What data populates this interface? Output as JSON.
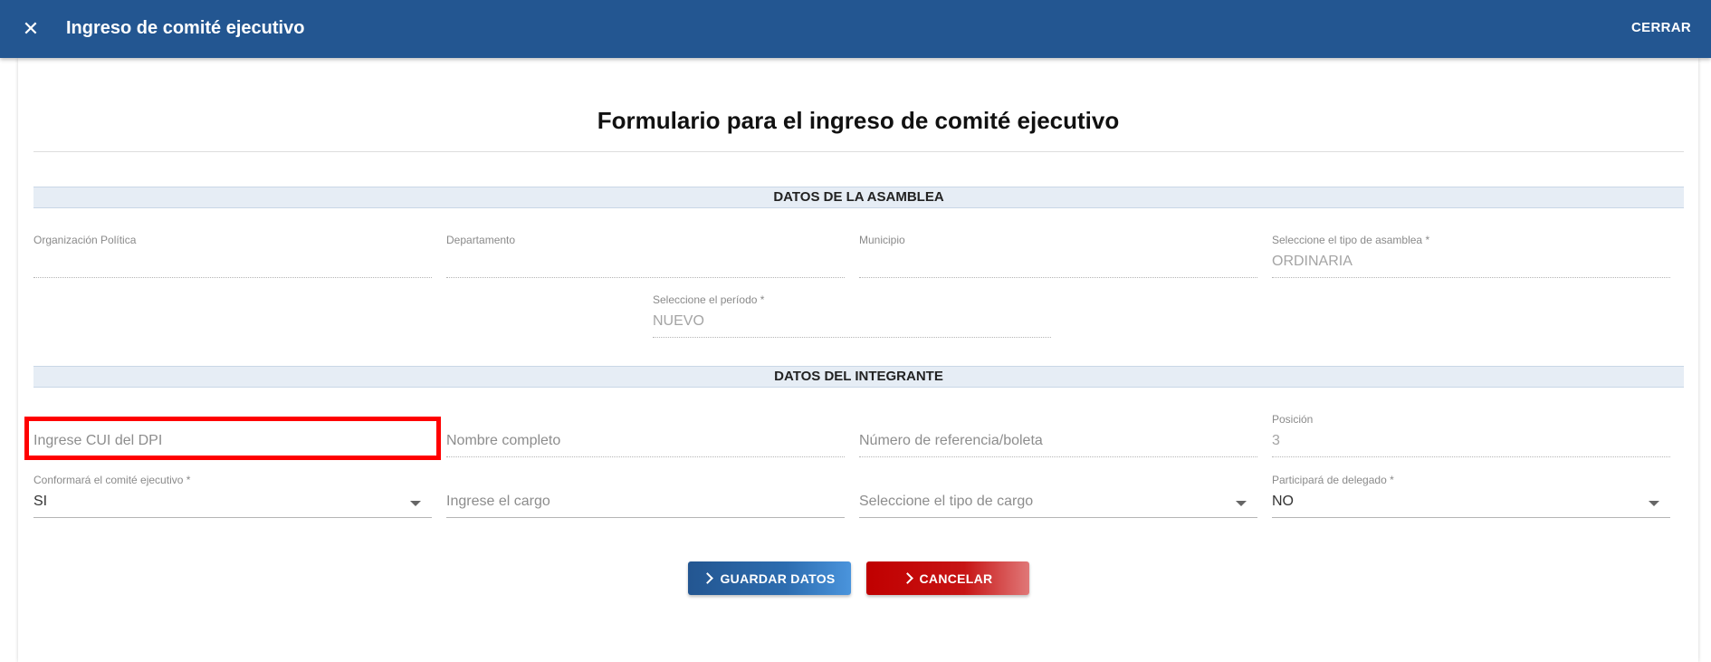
{
  "topbar": {
    "title": "Ingreso de comité ejecutivo",
    "close_symbol": "✕",
    "cerrar_label": "CERRAR"
  },
  "form": {
    "title": "Formulario para el ingreso de comité ejecutivo"
  },
  "section_asamblea": {
    "header": "DATOS DE LA ASAMBLEA",
    "organizacion": {
      "label": "Organización Política",
      "value": ""
    },
    "departamento": {
      "label": "Departamento",
      "value": ""
    },
    "municipio": {
      "label": "Municipio",
      "value": ""
    },
    "tipo_asamblea": {
      "label": "Seleccione el tipo de asamblea *",
      "value": "ORDINARIA"
    },
    "periodo": {
      "label": "Seleccione el período *",
      "value": "NUEVO"
    }
  },
  "section_integrante": {
    "header": "DATOS DEL INTEGRANTE",
    "cui": {
      "placeholder": "Ingrese CUI del DPI"
    },
    "nombre": {
      "placeholder": "Nombre completo"
    },
    "referencia": {
      "placeholder": "Número de referencia/boleta"
    },
    "posicion": {
      "label": "Posición",
      "value": "3"
    },
    "conformara": {
      "label": "Conformará el comité ejecutivo *",
      "value": "SI"
    },
    "cargo": {
      "placeholder": "Ingrese el cargo"
    },
    "tipo_cargo": {
      "placeholder": "Seleccione el tipo de cargo"
    },
    "delegado": {
      "label": "Participará de delegado *",
      "value": "NO"
    }
  },
  "actions": {
    "save_label": "GUARDAR DATOS",
    "cancel_label": "CANCELAR"
  },
  "colors": {
    "header_bg": "#235691",
    "highlight": "#ff0000",
    "cancel": "#c00000"
  }
}
